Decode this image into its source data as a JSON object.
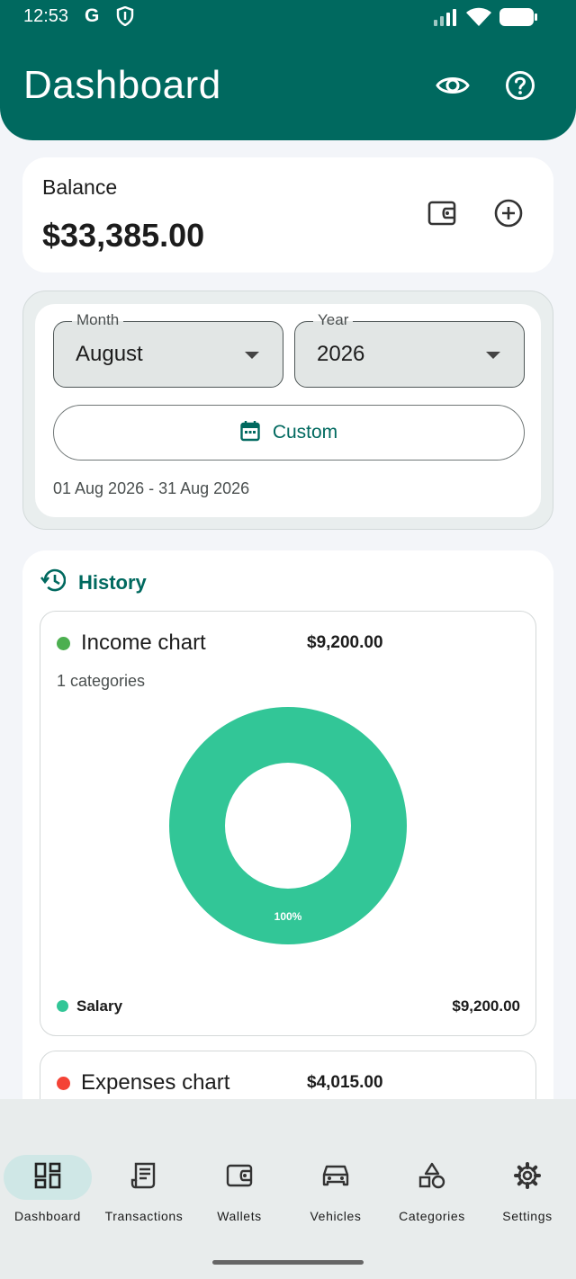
{
  "status_bar": {
    "time": "12:53",
    "g_letter": "G"
  },
  "header": {
    "title": "Dashboard"
  },
  "balance": {
    "label": "Balance",
    "value": "$33,385.00"
  },
  "filters": {
    "month": {
      "label": "Month",
      "value": "August"
    },
    "year": {
      "label": "Year",
      "value": "2026"
    },
    "custom_label": "Custom",
    "date_range": "01 Aug 2026 - 31 Aug 2026"
  },
  "history": {
    "title": "History",
    "income": {
      "title": "Income chart",
      "total": "$9,200.00",
      "categories_text": "1 categories",
      "dot_color": "#4caf50",
      "legend": [
        {
          "name": "Salary",
          "value": "$9,200.00",
          "color": "#32c697"
        }
      ]
    },
    "expenses": {
      "title": "Expenses chart",
      "total": "$4,015.00",
      "dot_color": "#f44336"
    }
  },
  "chart_data": {
    "type": "pie",
    "title": "Income chart",
    "categories": [
      "Salary"
    ],
    "values": [
      9200
    ],
    "percent_labels": [
      "100%"
    ],
    "donut": true,
    "colors": [
      "#32c697"
    ]
  },
  "nav": {
    "items": [
      {
        "label": "Dashboard",
        "icon": "dashboard-icon",
        "active": true
      },
      {
        "label": "Transactions",
        "icon": "receipt-icon",
        "active": false
      },
      {
        "label": "Wallets",
        "icon": "wallet-icon",
        "active": false
      },
      {
        "label": "Vehicles",
        "icon": "car-icon",
        "active": false
      },
      {
        "label": "Categories",
        "icon": "shapes-icon",
        "active": false
      },
      {
        "label": "Settings",
        "icon": "gear-icon",
        "active": false
      }
    ]
  },
  "colors": {
    "primary": "#00695f",
    "donut": "#32c697",
    "nav_active": "#cfe7e6"
  }
}
